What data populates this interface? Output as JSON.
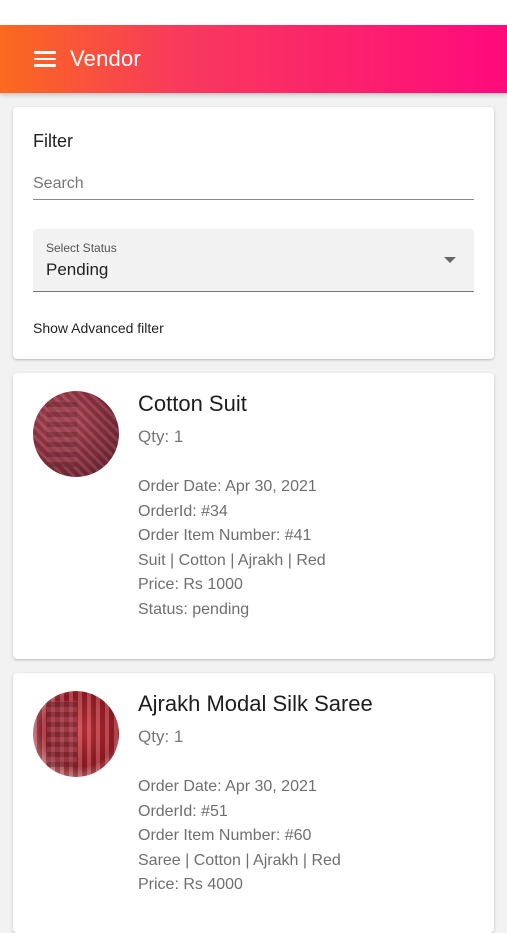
{
  "app": {
    "title": "Vendor"
  },
  "filter": {
    "title": "Filter",
    "search_placeholder": "Search",
    "status_label": "Select Status",
    "status_value": "Pending",
    "advanced_link": "Show Advanced filter"
  },
  "orders": [
    {
      "name": "Cotton Suit",
      "qty": "Qty: 1",
      "order_date": "Order Date: Apr 30, 2021",
      "order_id": "OrderId: #34",
      "item_number": "Order Item Number: #41",
      "attributes": "Suit | Cotton | Ajrakh | Red",
      "price": "Price: Rs 1000",
      "status": "Status: pending"
    },
    {
      "name": "Ajrakh Modal Silk Saree",
      "qty": "Qty: 1",
      "order_date": "Order Date: Apr 30, 2021",
      "order_id": "OrderId: #51",
      "item_number": "Order Item Number: #60",
      "attributes": "Saree | Cotton | Ajrakh | Red",
      "price": "Price: Rs 4000"
    }
  ],
  "colors": {
    "appbar_start": "#fb6a1e",
    "appbar_end": "#ff0a7c"
  }
}
